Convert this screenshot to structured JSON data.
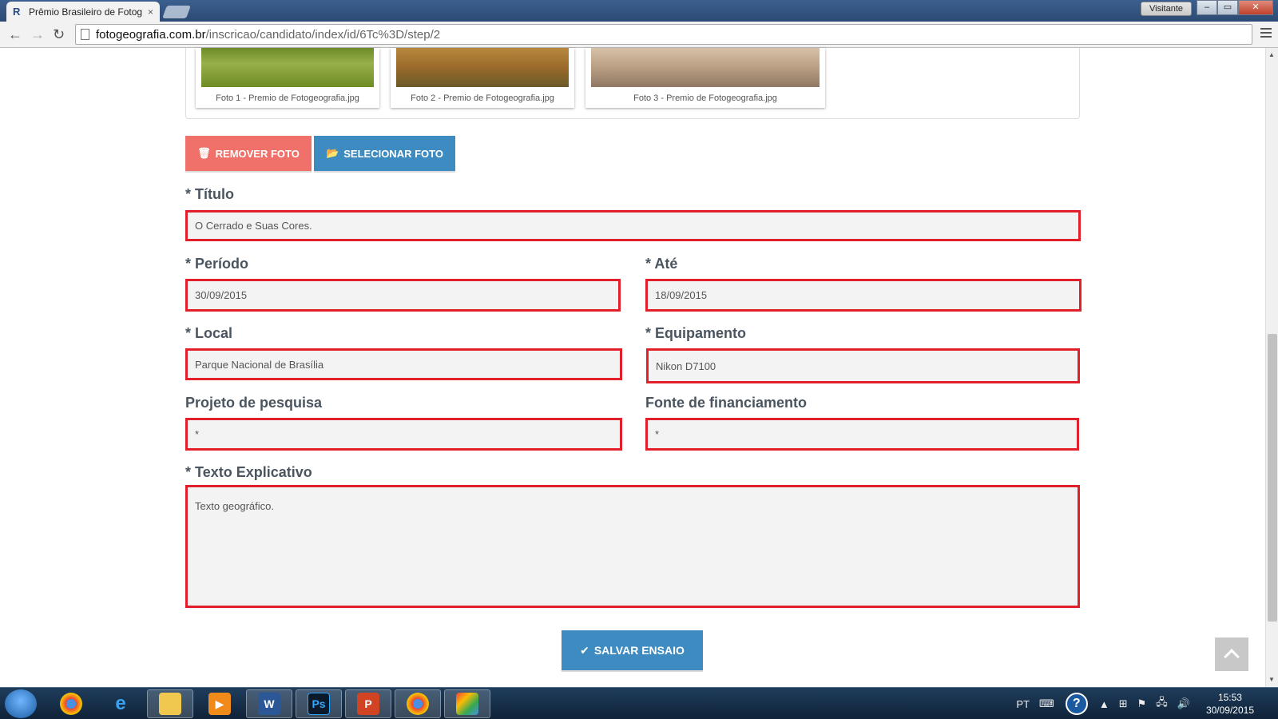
{
  "browser": {
    "tab_title": "Prêmio Brasileiro de Fotog",
    "tab_close": "×",
    "url_host": "fotogeografia.com.br",
    "url_path": "/inscricao/candidato/index/id/6Tc%3D/step/2",
    "visitor_label": "Visitante",
    "back": "←",
    "forward": "→",
    "reload": "↻"
  },
  "photos": [
    {
      "caption": "Foto 1 - Premio de Fotogeografia.jpg"
    },
    {
      "caption": "Foto 2 - Premio de Fotogeografia.jpg"
    },
    {
      "caption": "Foto 3 - Premio de Fotogeografia.jpg"
    }
  ],
  "actions": {
    "remove_label": "REMOVER FOTO",
    "select_label": "SELECIONAR FOTO",
    "save_label": "SALVAR ENSAIO"
  },
  "form": {
    "required_mark": "*",
    "titulo": {
      "label": "Título",
      "value": "O Cerrado e Suas Cores."
    },
    "periodo": {
      "label": "Período",
      "value": "30/09/2015"
    },
    "ate": {
      "label": "Até",
      "value": "18/09/2015"
    },
    "local": {
      "label": "Local",
      "value": "Parque Nacional de Brasília"
    },
    "equipamento": {
      "label": "Equipamento",
      "value": "Nikon D7100"
    },
    "projeto": {
      "label": "Projeto de pesquisa",
      "value": "*"
    },
    "fonte": {
      "label": "Fonte de financiamento",
      "value": "*"
    },
    "texto": {
      "label": "Texto Explicativo",
      "value": "Texto geográfico."
    }
  },
  "taskbar": {
    "lang": "PT",
    "time": "15:53",
    "date": "30/09/2015",
    "items": [
      "chrome-icon",
      "ie-icon",
      "explorer-icon",
      "media-player-icon",
      "word-icon",
      "photoshop-icon",
      "powerpoint-icon",
      "chrome-icon",
      "paint-icon"
    ]
  },
  "colors": {
    "error_border": "#e2202c",
    "primary": "#3d8bc0",
    "danger": "#f0706a"
  }
}
